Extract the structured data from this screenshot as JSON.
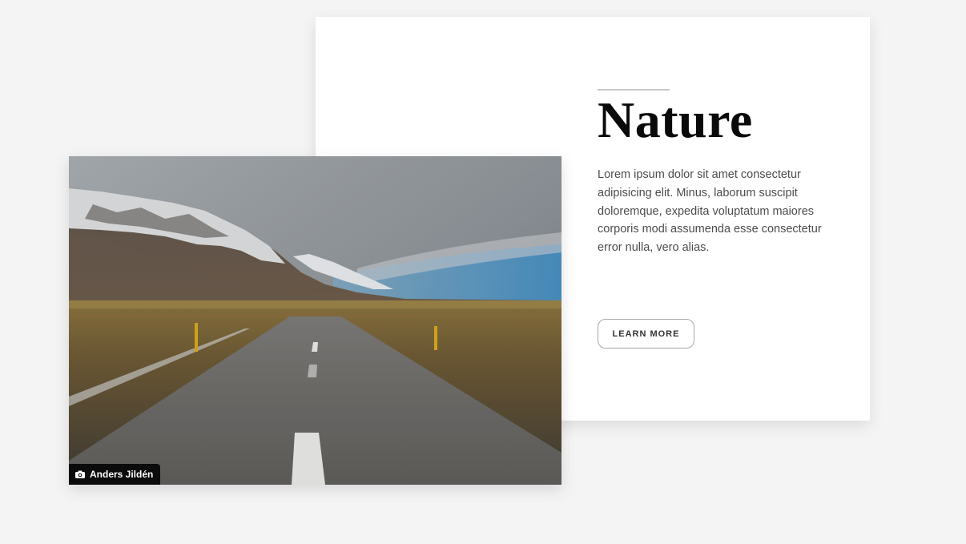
{
  "feature": {
    "title": "Nature",
    "description": "Lorem ipsum dolor sit amet consectetur adipisicing elit. Minus, laborum suscipit doloremque, expedita voluptatum maiores corporis modi assumenda esse consectetur error nulla, vero alias.",
    "button_label": "LEARN MORE"
  },
  "photo": {
    "credit_icon": "camera-icon",
    "credit_name": "Anders Jildén"
  },
  "colors": {
    "background": "#f4f4f4",
    "card": "#ffffff",
    "title": "#0a0a0a",
    "text": "#4c4c4c",
    "credit_bg": "#0b0b0b"
  }
}
